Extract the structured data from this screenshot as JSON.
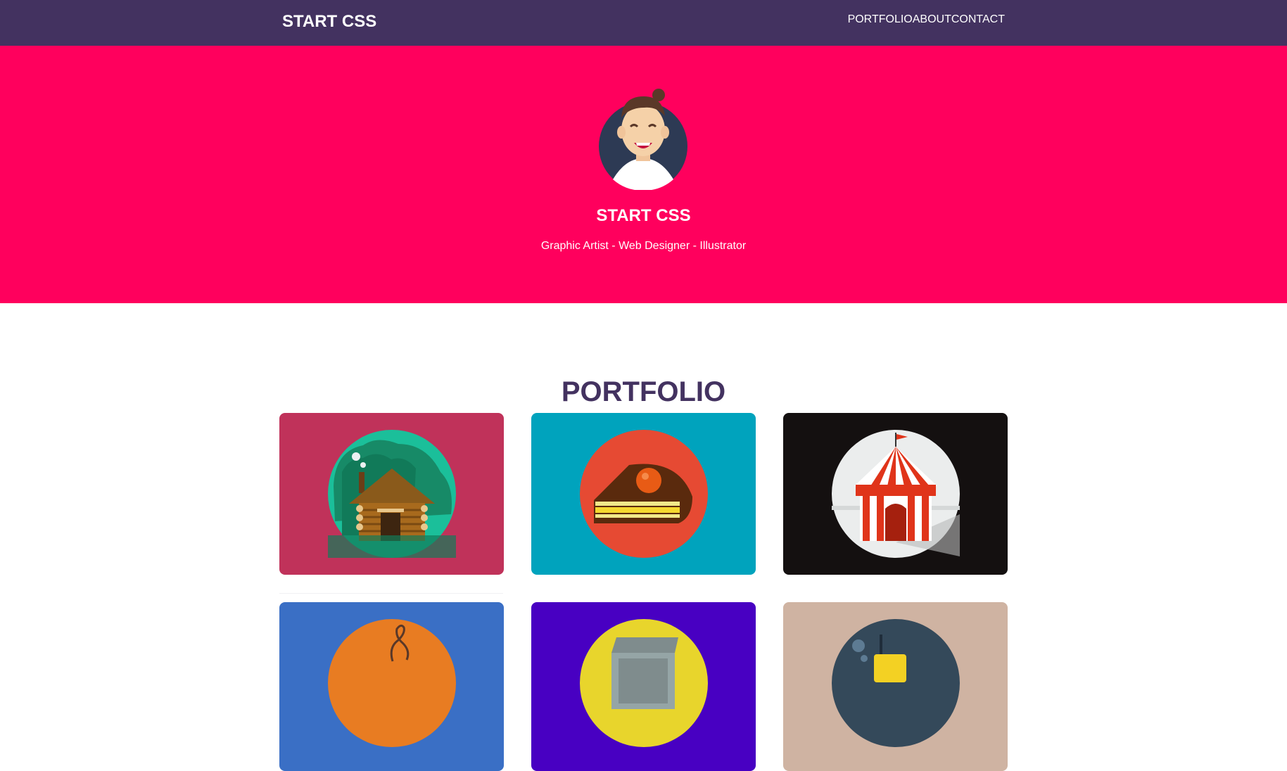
{
  "header": {
    "brand": "START CSS",
    "nav": [
      "PORTFOLIO",
      "ABOUT",
      "CONTACT"
    ]
  },
  "hero": {
    "title": "START CSS",
    "subtitle": "Graphic Artist - Web Designer - Illustrator",
    "avatar_icon": "smiling-man-avatar"
  },
  "portfolio": {
    "title": "PORTFOLIO",
    "items": [
      {
        "icon": "log-cabin-icon",
        "bg": "#c0325a",
        "circle": "#1bbf9a"
      },
      {
        "icon": "cake-slice-icon",
        "bg": "#00a3bd",
        "circle": "#e64a33"
      },
      {
        "icon": "circus-tent-icon",
        "bg": "#141010",
        "circle": "#ebeded"
      },
      {
        "icon": "balloon-icon",
        "bg": "#3a6fc5",
        "circle": "#e87c22"
      },
      {
        "icon": "safe-box-icon",
        "bg": "#4800c2",
        "circle": "#e8d52c"
      },
      {
        "icon": "submarine-icon",
        "bg": "#cfb3a2",
        "circle": "#34495a"
      }
    ]
  },
  "colors": {
    "navbar": "#433260",
    "hero": "#ff005d",
    "heading": "#433260"
  }
}
